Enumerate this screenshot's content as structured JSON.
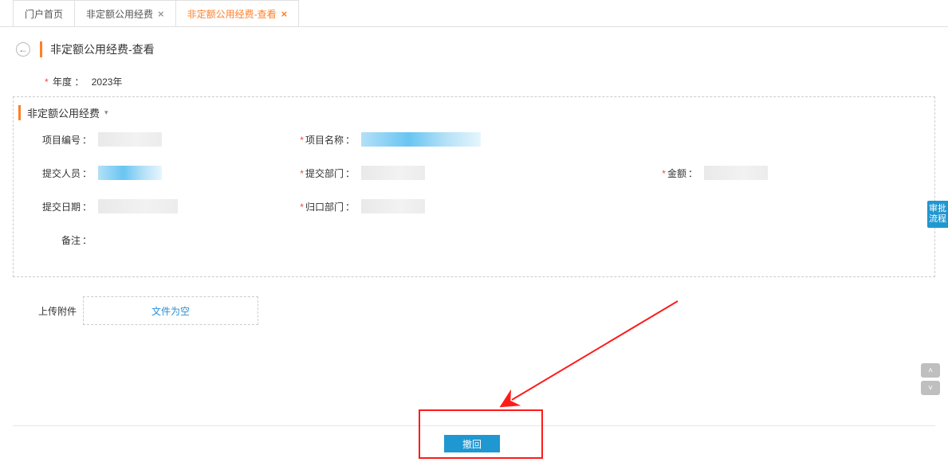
{
  "tabs": {
    "home": "门户首页",
    "tab1": "非定额公用经费",
    "tab2": "非定额公用经费-查看"
  },
  "pageTitle": "非定额公用经费-查看",
  "year": {
    "label": "年度",
    "value": "2023年"
  },
  "section": {
    "title": "非定额公用经费"
  },
  "fields": {
    "projectNo": {
      "label": "项目编号"
    },
    "projectName": {
      "label": "项目名称"
    },
    "submitter": {
      "label": "提交人员"
    },
    "submitDept": {
      "label": "提交部门"
    },
    "amount": {
      "label": "金额"
    },
    "submitDate": {
      "label": "提交日期"
    },
    "ownerDept": {
      "label": "归口部门"
    },
    "remark": {
      "label": "备注"
    }
  },
  "upload": {
    "label": "上传附件",
    "empty": "文件为空"
  },
  "buttons": {
    "withdraw": "撤回"
  },
  "side": {
    "approve": "审批流程"
  }
}
